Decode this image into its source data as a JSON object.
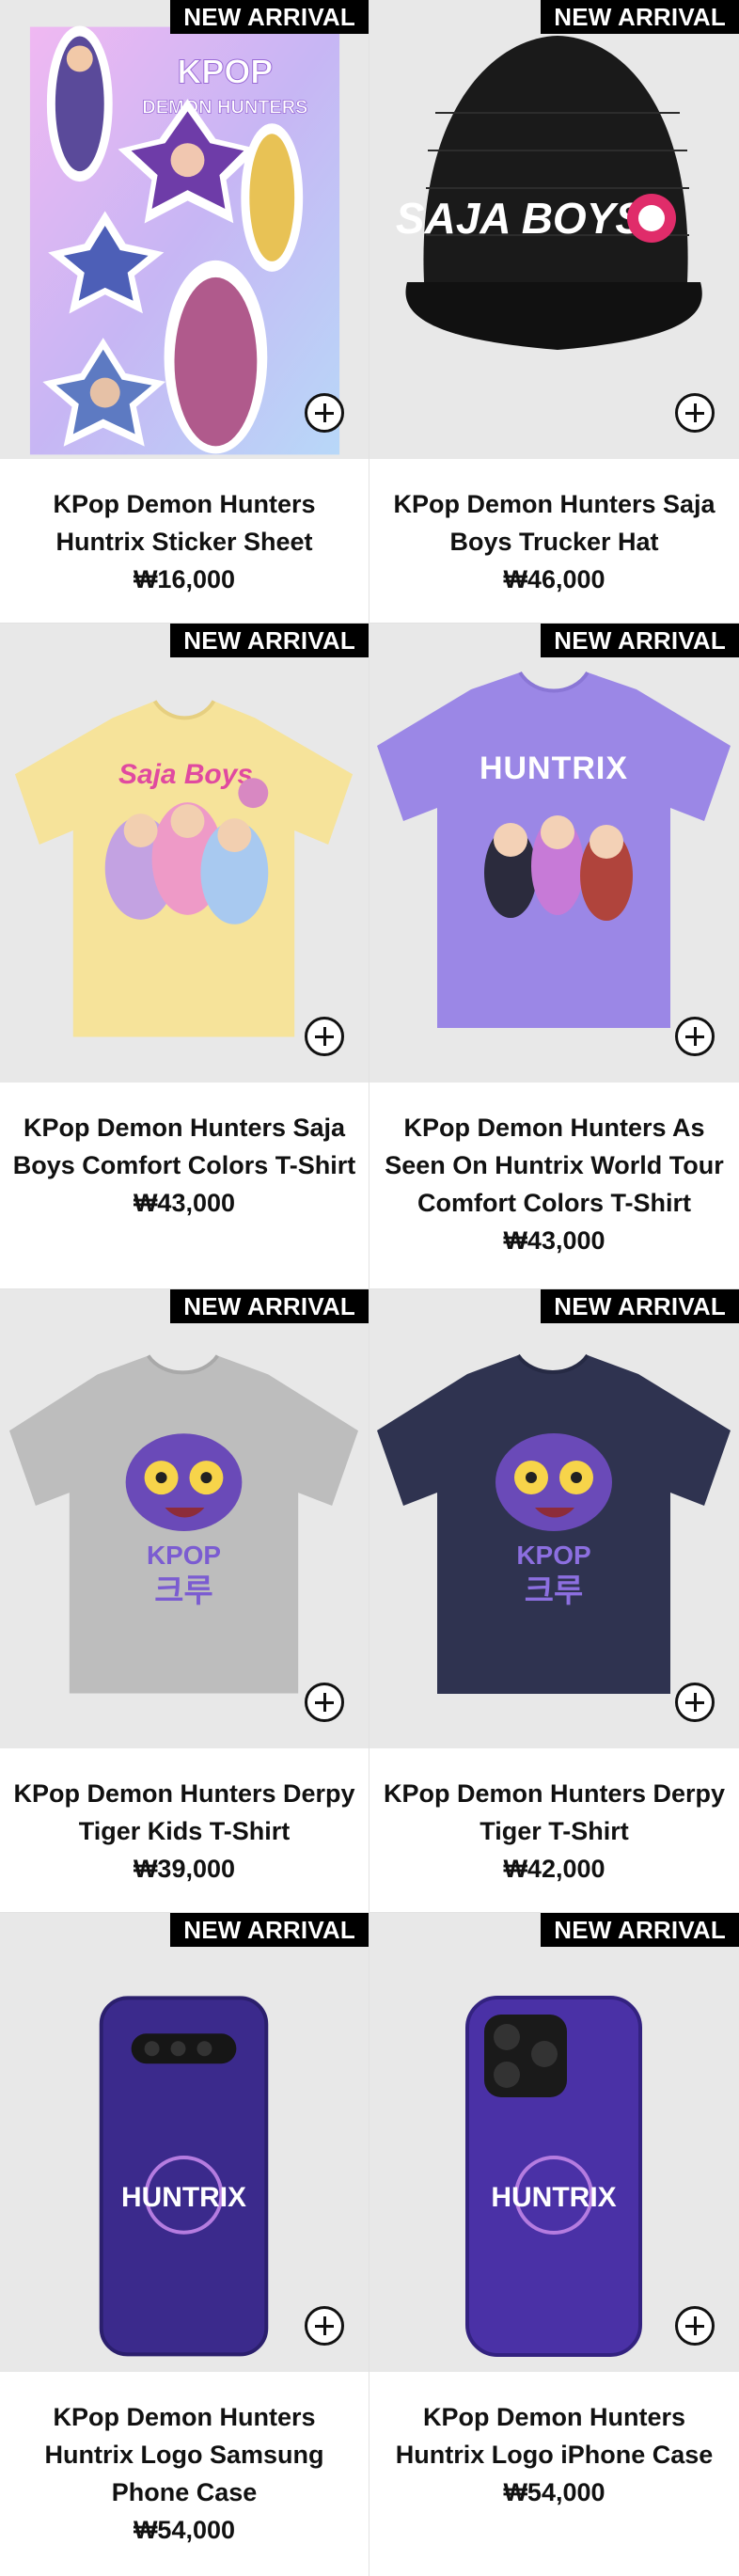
{
  "badge_label": "NEW ARRIVAL",
  "products": [
    {
      "name": "KPop Demon Hunters Huntrix Sticker Sheet",
      "price": "₩16,000",
      "art": "sticker-sheet",
      "art_text": [
        "KPOP",
        "DEMON HUNTERS"
      ]
    },
    {
      "name": "KPop Demon Hunters Saja Boys Trucker Hat",
      "price": "₩46,000",
      "art": "trucker-hat",
      "art_text": [
        "SAJA BOYS"
      ]
    },
    {
      "name": "KPop Demon Hunters Saja Boys Comfort Colors T-Shirt",
      "price": "₩43,000",
      "art": "tshirt-yellow",
      "art_text": [
        "Saja Boys"
      ]
    },
    {
      "name": "KPop Demon Hunters As Seen On Huntrix World Tour Comfort Colors T-Shirt",
      "price": "₩43,000",
      "art": "tshirt-purple",
      "art_text": [
        "HUNTRIX"
      ]
    },
    {
      "name": "KPop Demon Hunters Derpy Tiger Kids T-Shirt",
      "price": "₩39,000",
      "art": "tshirt-grey",
      "art_text": [
        "KPOP",
        "크루"
      ]
    },
    {
      "name": "KPop Demon Hunters Derpy Tiger T-Shirt",
      "price": "₩42,000",
      "art": "tshirt-navy",
      "art_text": [
        "KPOP",
        "크루"
      ]
    },
    {
      "name": "KPop Demon Hunters Huntrix Logo Samsung Phone Case",
      "price": "₩54,000",
      "art": "samsung-case",
      "art_text": [
        "HUNTRIX"
      ]
    },
    {
      "name": "KPop Demon Hunters Huntrix Logo iPhone Case",
      "price": "₩54,000",
      "art": "iphone-case",
      "art_text": [
        "HUNTRIX"
      ]
    }
  ]
}
